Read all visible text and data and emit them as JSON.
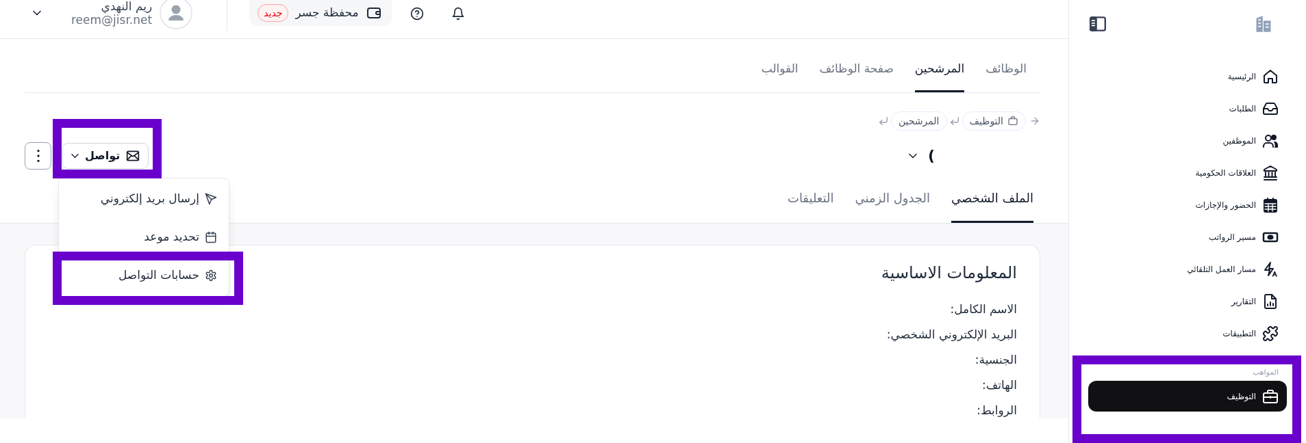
{
  "header": {
    "wallet": {
      "label": "محفظة جسر",
      "badge": "جديد"
    },
    "user": {
      "name": "ريم النهدي",
      "email": "reem@jisr.net"
    }
  },
  "tabs": [
    {
      "label": "الوظائف",
      "selected": false
    },
    {
      "label": "المرشحين",
      "selected": true
    },
    {
      "label": "صفحة الوظائف",
      "selected": false
    },
    {
      "label": "القوالب",
      "selected": false
    }
  ],
  "breadcrumb": [
    {
      "label": "التوظيف"
    },
    {
      "label": "المرشحين"
    }
  ],
  "candidate": {
    "name": ")"
  },
  "communicate": {
    "label": "تواصل",
    "expanded": true,
    "highlighted": true,
    "menu": [
      {
        "label": "إرسال بريد إلكتروني",
        "highlighted": false
      },
      {
        "label": "تحديد موعد",
        "highlighted": false
      },
      {
        "label": "حسابات التواصل",
        "highlighted": true
      }
    ]
  },
  "profile_tabs": [
    {
      "label": "الملف الشخصي",
      "selected": true
    },
    {
      "label": "الجدول الزمني",
      "selected": false
    },
    {
      "label": "التعليقات",
      "selected": false
    }
  ],
  "basic_info": {
    "title": "المعلومات الاساسية",
    "fields": [
      "الاسم الكامل:",
      "البريد الإلكتروني الشخصي:",
      "الجنسية:",
      "الهاتف:",
      "الروابط:"
    ]
  },
  "sidebar": {
    "items": [
      {
        "label": "الرئيسية",
        "selected": false
      },
      {
        "label": "الطلبات",
        "selected": false
      },
      {
        "label": "الموظفين",
        "selected": false
      },
      {
        "label": "العلاقات الحكومية",
        "selected": false
      },
      {
        "label": "الحضور والإجازات",
        "selected": false
      },
      {
        "label": "مسير الرواتب",
        "selected": false
      },
      {
        "label": "مسار العمل التلقائي",
        "selected": false
      },
      {
        "label": "التقارير",
        "selected": false
      },
      {
        "label": "التطبيقات",
        "selected": false
      }
    ],
    "sections": [
      {
        "title": "المواهب",
        "highlighted": true,
        "items": [
          {
            "label": "التوظيف",
            "selected": true
          }
        ]
      }
    ]
  }
}
